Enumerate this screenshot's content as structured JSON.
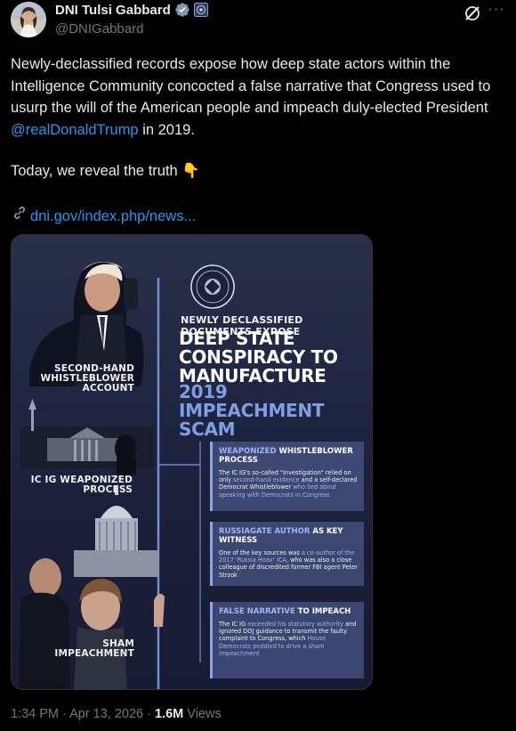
{
  "author": {
    "name": "DNI Tulsi Gabbard",
    "handle": "@DNIGabbard",
    "verified_color": "#829aab"
  },
  "tweet": {
    "text_before": "Newly-declassified records expose how deep state actors within the Intelligence Community concocted a false narrative that Congress used to usurp the will of the American people and impeach duly-elected President ",
    "mention": "@realDonaldTrump",
    "text_after": " in 2019.",
    "today": "Today, we reveal the truth 👇",
    "link": "dni.gov/index.php/news..."
  },
  "media": {
    "labels": {
      "secondhand": "SECOND-HAND WHISTLEBLOWER ACCOUNT",
      "icig": "IC IG WEAPONIZED PROCESS",
      "sham": "SHAM IMPEACHMENT"
    },
    "headline_sub": "NEWLY DECLASSIFIED DOCUMENTS EXPOSE",
    "headline_main": "DEEP STATE CONSPIRACY TO MANUFACTURE",
    "headline_blue": "2019 IMPEACHMENT SCAM",
    "boxes": [
      {
        "title_hl": "WEAPONIZED",
        "title_rest": " WHISTLEBLOWER PROCESS",
        "body_1": "The IC IG's so-called \"investigation\" relied on only ",
        "body_hl1": "second-hand evidence",
        "body_2": " and a self-declared Democrat Whistleblower ",
        "body_hl2": "who lied about speaking with Democrats in Congress",
        "body_3": ""
      },
      {
        "title_hl": "RUSSIAGATE AUTHOR",
        "title_rest": " AS KEY WITNESS",
        "body_1": "One of the key sources was ",
        "body_hl1": "a co-author of the 2017 'Russia Hoax' ICA",
        "body_2": ", who was also a close colleague of discredited former FBI agent Peter Strzok",
        "body_hl2": "",
        "body_3": ""
      },
      {
        "title_hl": "FALSE NARRATIVE",
        "title_rest": " TO IMPEACH",
        "body_1": "The IC IG ",
        "body_hl1": "exceeded his statutory authority",
        "body_2": " and ignored DOJ guidance to transmit the faulty complaint to Congress, which ",
        "body_hl2": "House Democrats peddled to drive a sham impeachment",
        "body_3": ""
      }
    ]
  },
  "footer": {
    "time": "1:34 PM · Apr 13, 2026 · ",
    "views_count": "1.6M",
    "views_label": " Views"
  }
}
